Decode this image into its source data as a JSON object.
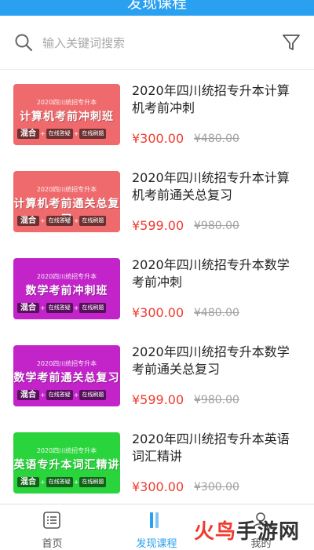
{
  "header": {
    "title": "发现课程"
  },
  "search": {
    "placeholder": "输入关键词搜索"
  },
  "courses": [
    {
      "thumb_line1": "2020四川统招专升本",
      "thumb_line2": "计算机考前冲刺班",
      "thumb_color": "#ef6a6d",
      "tag_main": "混合",
      "tag_a": "在线答疑",
      "tag_b": "在线刷题",
      "title": "2020年四川统招专升本计算机考前冲刺",
      "price": "¥300.00",
      "old_price": "¥480.00"
    },
    {
      "thumb_line1": "2020四川统招专升本",
      "thumb_line2": "计算机考前通关总复习",
      "thumb_color": "#ef6a6d",
      "tag_main": "混合",
      "tag_a": "在线答疑",
      "tag_b": "在线刷题",
      "title": "2020年四川统招专升本计算机考前通关总复习",
      "price": "¥599.00",
      "old_price": "¥980.00"
    },
    {
      "thumb_line1": "2020四川统招专升本",
      "thumb_line2": "数学考前冲刺班",
      "thumb_color": "#c224c9",
      "tag_main": "混合",
      "tag_a": "在线答疑",
      "tag_b": "在线刷题",
      "title": "2020年四川统招专升本数学考前冲刺",
      "price": "¥300.00",
      "old_price": "¥480.00"
    },
    {
      "thumb_line1": "2020四川统招专升本",
      "thumb_line2": "数学考前通关总复习",
      "thumb_color": "#c224c9",
      "tag_main": "混合",
      "tag_a": "在线答疑",
      "tag_b": "在线刷题",
      "title": "2020年四川统招专升本数学考前通关总复习",
      "price": "¥599.00",
      "old_price": "¥980.00"
    },
    {
      "thumb_line1": "2020四川统招专升本",
      "thumb_line2": "英语专升本词汇精讲",
      "thumb_color": "#2ad43c",
      "tag_main": "混合",
      "tag_a": "在线答疑",
      "tag_b": "在线刷题",
      "title": "2020年四川统招专升本英语词汇精讲",
      "price": "¥300.00",
      "old_price": "¥300.00"
    }
  ],
  "tabs": [
    {
      "label": "首页",
      "icon": "home-list-icon"
    },
    {
      "label": "发现课程",
      "icon": "discover-icon"
    },
    {
      "label": "我的",
      "icon": "profile-icon"
    }
  ],
  "watermark": {
    "part1": "火鸟",
    "part2": "手游网"
  },
  "colors": {
    "accent": "#2aa0f0",
    "price": "#ef3b2f"
  }
}
